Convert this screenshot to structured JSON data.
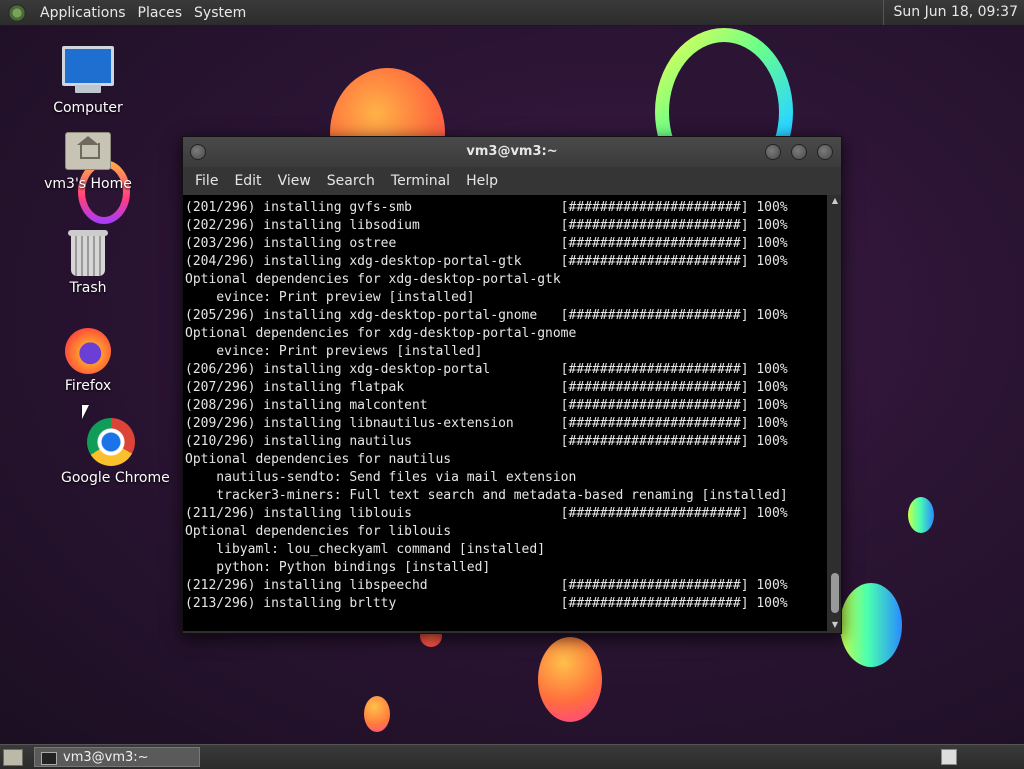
{
  "top_panel": {
    "menus": [
      "Applications",
      "Places",
      "System"
    ],
    "clock": "Sun Jun 18, 09:37"
  },
  "desktop_icons": [
    {
      "label": "Computer",
      "icon": "computer-icon"
    },
    {
      "label": "vm3's Home",
      "icon": "home-folder-icon"
    },
    {
      "label": "Trash",
      "icon": "trash-icon"
    },
    {
      "label": "Firefox",
      "icon": "firefox-icon"
    },
    {
      "label": "Google Chrome",
      "icon": "chrome-icon"
    }
  ],
  "terminal": {
    "title": "vm3@vm3:~",
    "menu": [
      "File",
      "Edit",
      "View",
      "Search",
      "Terminal",
      "Help"
    ],
    "lines": [
      "(201/296) installing gvfs-smb                   [######################] 100%",
      "(202/296) installing libsodium                  [######################] 100%",
      "(203/296) installing ostree                     [######################] 100%",
      "(204/296) installing xdg-desktop-portal-gtk     [######################] 100%",
      "Optional dependencies for xdg-desktop-portal-gtk",
      "    evince: Print preview [installed]",
      "(205/296) installing xdg-desktop-portal-gnome   [######################] 100%",
      "Optional dependencies for xdg-desktop-portal-gnome",
      "    evince: Print previews [installed]",
      "(206/296) installing xdg-desktop-portal         [######################] 100%",
      "(207/296) installing flatpak                    [######################] 100%",
      "(208/296) installing malcontent                 [######################] 100%",
      "(209/296) installing libnautilus-extension      [######################] 100%",
      "(210/296) installing nautilus                   [######################] 100%",
      "Optional dependencies for nautilus",
      "    nautilus-sendto: Send files via mail extension",
      "    tracker3-miners: Full text search and metadata-based renaming [installed]",
      "(211/296) installing liblouis                   [######################] 100%",
      "Optional dependencies for liblouis",
      "    libyaml: lou_checkyaml command [installed]",
      "    python: Python bindings [installed]",
      "(212/296) installing libspeechd                 [######################] 100%",
      "(213/296) installing brltty                     [######################] 100%"
    ]
  },
  "taskbar": {
    "task_label": "vm3@vm3:~"
  }
}
